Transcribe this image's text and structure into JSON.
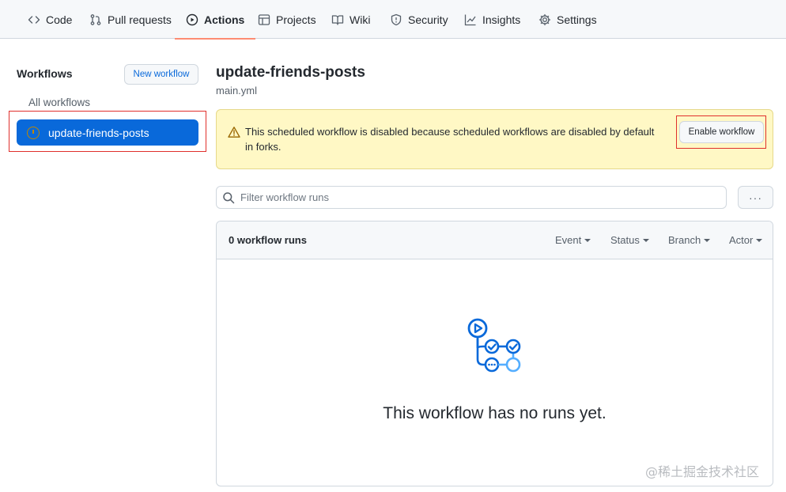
{
  "nav": {
    "tabs": [
      {
        "label": "Code",
        "icon": "code-icon"
      },
      {
        "label": "Pull requests",
        "icon": "pull-request-icon"
      },
      {
        "label": "Actions",
        "icon": "play-icon",
        "active": true
      },
      {
        "label": "Projects",
        "icon": "table-icon"
      },
      {
        "label": "Wiki",
        "icon": "book-icon"
      },
      {
        "label": "Security",
        "icon": "shield-icon"
      },
      {
        "label": "Insights",
        "icon": "graph-icon"
      },
      {
        "label": "Settings",
        "icon": "gear-icon"
      }
    ],
    "active_underline_color": "#fd8c73"
  },
  "sidebar": {
    "title": "Workflows",
    "new_workflow_label": "New workflow",
    "all_workflows_label": "All workflows",
    "items": [
      {
        "label": "update-friends-posts",
        "selected": true,
        "status_icon": "disabled-workflow-icon"
      }
    ],
    "selected_color": "#0969da"
  },
  "main": {
    "title": "update-friends-posts",
    "file": "main.yml",
    "banner": {
      "message": "This scheduled workflow is disabled because scheduled workflows are disabled by default in forks.",
      "button_label": "Enable workflow",
      "icon": "alert-icon",
      "background": "#fff8c5"
    },
    "filter": {
      "placeholder": "Filter workflow runs",
      "value": "",
      "more_label": "···"
    },
    "runs": {
      "count_label": "0 workflow runs",
      "filters": [
        "Event",
        "Status",
        "Branch",
        "Actor"
      ],
      "empty_message": "This workflow has no runs yet.",
      "empty_icon": "workflow-graph-icon"
    }
  },
  "highlight_color": "#e0302c",
  "watermark": "@稀土掘金技术社区"
}
